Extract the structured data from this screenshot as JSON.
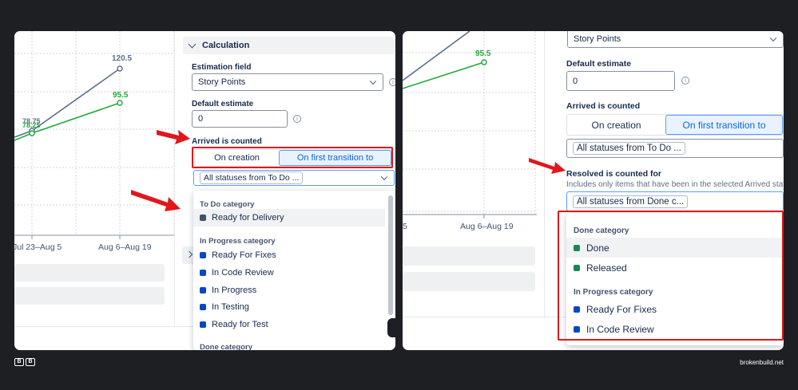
{
  "left": {
    "chart": {
      "value_top": "120.5",
      "value_green": "95.5",
      "value_overlap_a": "78.75",
      "value_overlap_b": "78.25",
      "xtick_1": "Jul 23–Aug 5",
      "xtick_2": "Aug 6–Aug 19"
    },
    "calc": {
      "section_title": "Calculation",
      "estimation_label": "Estimation field",
      "estimation_value": "Story Points",
      "default_estimate_label": "Default estimate",
      "default_estimate_value": "0",
      "arrived_label": "Arrived is counted",
      "seg_on_creation": "On creation",
      "seg_first_transition": "On first transition to",
      "statuses_value": "All statuses from To Do ..."
    },
    "dropdown": {
      "cat_todo": "To Do category",
      "item_ready_delivery": "Ready for Delivery",
      "cat_inprogress": "In Progress category",
      "item_ready_fixes": "Ready For Fixes",
      "item_code_review": "In Code Review",
      "item_in_progress": "In Progress",
      "item_in_testing": "In Testing",
      "item_ready_test": "Ready for Test",
      "cat_done": "Done category"
    }
  },
  "right": {
    "chart": {
      "value_green": "95.5",
      "xtick_1": "5",
      "xtick_2": "Aug 6–Aug 19"
    },
    "calc": {
      "estimation_value": "Story Points",
      "default_estimate_label": "Default estimate",
      "default_estimate_value": "0",
      "arrived_label": "Arrived is counted",
      "seg_on_creation": "On creation",
      "seg_first_transition": "On first transition to",
      "statuses_value": "All statuses from To Do ...",
      "resolved_label": "Resolved is counted for",
      "resolved_help": "Includes only items that have been in the selected Arrived stat",
      "resolved_value": "All statuses from Done c..."
    },
    "dropdown": {
      "cat_done": "Done category",
      "item_done": "Done",
      "item_released": "Released",
      "cat_inprogress": "In Progress category",
      "item_ready_fixes": "Ready For Fixes",
      "item_code_review": "In Code Review"
    }
  },
  "footer": {
    "logo_b1": "B",
    "logo_b2": "B",
    "site": "brokenbuild.net"
  },
  "colors": {
    "line_gray": "#5b7088",
    "line_green": "#22a83b",
    "status_blue": "#0747c7",
    "status_gray": "#42526e",
    "status_green": "#1f845a",
    "highlight_red": "#e2161b"
  }
}
